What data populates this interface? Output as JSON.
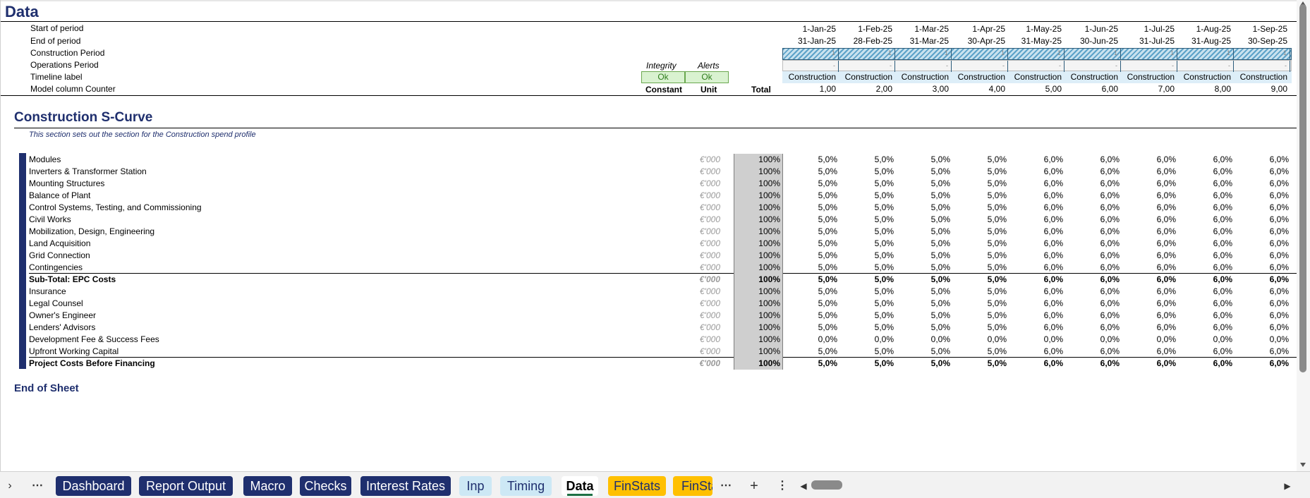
{
  "sheet_title": "Data",
  "timeline_labels": [
    "Start of period",
    "End of period",
    "Construction Period",
    "Operations Period",
    "Timeline label",
    "Model column Counter"
  ],
  "integrity": {
    "label": "Integrity",
    "value": "Ok"
  },
  "alerts": {
    "label": "Alerts",
    "value": "Ok"
  },
  "col_headers": {
    "constant": "Constant",
    "unit": "Unit",
    "total": "Total"
  },
  "period_columns": [
    {
      "start": "1-Jan-25",
      "end": "31-Jan-25",
      "construction": "1",
      "operations": "-",
      "label": "Construction",
      "counter": "1,00"
    },
    {
      "start": "1-Feb-25",
      "end": "28-Feb-25",
      "construction": "1",
      "operations": "-",
      "label": "Construction",
      "counter": "2,00"
    },
    {
      "start": "1-Mar-25",
      "end": "31-Mar-25",
      "construction": "1",
      "operations": "-",
      "label": "Construction",
      "counter": "3,00"
    },
    {
      "start": "1-Apr-25",
      "end": "30-Apr-25",
      "construction": "1",
      "operations": "-",
      "label": "Construction",
      "counter": "4,00"
    },
    {
      "start": "1-May-25",
      "end": "31-May-25",
      "construction": "1",
      "operations": "-",
      "label": "Construction",
      "counter": "5,00"
    },
    {
      "start": "1-Jun-25",
      "end": "30-Jun-25",
      "construction": "1",
      "operations": "-",
      "label": "Construction",
      "counter": "6,00"
    },
    {
      "start": "1-Jul-25",
      "end": "31-Jul-25",
      "construction": "1",
      "operations": "-",
      "label": "Construction",
      "counter": "7,00"
    },
    {
      "start": "1-Aug-25",
      "end": "31-Aug-25",
      "construction": "1",
      "operations": "-",
      "label": "Construction",
      "counter": "8,00"
    },
    {
      "start": "1-Sep-25",
      "end": "30-Sep-25",
      "construction": "1",
      "operations": "-",
      "label": "Construction",
      "counter": "9,00"
    }
  ],
  "section": {
    "title": "Construction S-Curve",
    "description": "This section sets out the section for the Construction spend profile"
  },
  "rows": [
    {
      "label": "Modules",
      "unit": "€'000",
      "constant": "100%",
      "values": [
        "5,0%",
        "5,0%",
        "5,0%",
        "5,0%",
        "6,0%",
        "6,0%",
        "6,0%",
        "6,0%",
        "6,0%"
      ],
      "bold": false
    },
    {
      "label": "Inverters & Transformer Station",
      "unit": "€'000",
      "constant": "100%",
      "values": [
        "5,0%",
        "5,0%",
        "5,0%",
        "5,0%",
        "6,0%",
        "6,0%",
        "6,0%",
        "6,0%",
        "6,0%"
      ],
      "bold": false
    },
    {
      "label": "Mounting Structures",
      "unit": "€'000",
      "constant": "100%",
      "values": [
        "5,0%",
        "5,0%",
        "5,0%",
        "5,0%",
        "6,0%",
        "6,0%",
        "6,0%",
        "6,0%",
        "6,0%"
      ],
      "bold": false
    },
    {
      "label": "Balance of Plant",
      "unit": "€'000",
      "constant": "100%",
      "values": [
        "5,0%",
        "5,0%",
        "5,0%",
        "5,0%",
        "6,0%",
        "6,0%",
        "6,0%",
        "6,0%",
        "6,0%"
      ],
      "bold": false
    },
    {
      "label": "Control Systems, Testing, and Commissioning",
      "unit": "€'000",
      "constant": "100%",
      "values": [
        "5,0%",
        "5,0%",
        "5,0%",
        "5,0%",
        "6,0%",
        "6,0%",
        "6,0%",
        "6,0%",
        "6,0%"
      ],
      "bold": false
    },
    {
      "label": "Civil Works",
      "unit": "€'000",
      "constant": "100%",
      "values": [
        "5,0%",
        "5,0%",
        "5,0%",
        "5,0%",
        "6,0%",
        "6,0%",
        "6,0%",
        "6,0%",
        "6,0%"
      ],
      "bold": false
    },
    {
      "label": "Mobilization, Design, Engineering",
      "unit": "€'000",
      "constant": "100%",
      "values": [
        "5,0%",
        "5,0%",
        "5,0%",
        "5,0%",
        "6,0%",
        "6,0%",
        "6,0%",
        "6,0%",
        "6,0%"
      ],
      "bold": false
    },
    {
      "label": "Land Acquisition",
      "unit": "€'000",
      "constant": "100%",
      "values": [
        "5,0%",
        "5,0%",
        "5,0%",
        "5,0%",
        "6,0%",
        "6,0%",
        "6,0%",
        "6,0%",
        "6,0%"
      ],
      "bold": false
    },
    {
      "label": "Grid Connection",
      "unit": "€'000",
      "constant": "100%",
      "values": [
        "5,0%",
        "5,0%",
        "5,0%",
        "5,0%",
        "6,0%",
        "6,0%",
        "6,0%",
        "6,0%",
        "6,0%"
      ],
      "bold": false
    },
    {
      "label": "Contingencies",
      "unit": "€'000",
      "constant": "100%",
      "values": [
        "5,0%",
        "5,0%",
        "5,0%",
        "5,0%",
        "6,0%",
        "6,0%",
        "6,0%",
        "6,0%",
        "6,0%"
      ],
      "bold": false
    },
    {
      "label": "Sub-Total: EPC Costs",
      "unit": "€'000",
      "constant": "100%",
      "values": [
        "5,0%",
        "5,0%",
        "5,0%",
        "5,0%",
        "6,0%",
        "6,0%",
        "6,0%",
        "6,0%",
        "6,0%"
      ],
      "bold": true
    },
    {
      "label": "Insurance",
      "unit": "€'000",
      "constant": "100%",
      "values": [
        "5,0%",
        "5,0%",
        "5,0%",
        "5,0%",
        "6,0%",
        "6,0%",
        "6,0%",
        "6,0%",
        "6,0%"
      ],
      "bold": false
    },
    {
      "label": "Legal Counsel",
      "unit": "€'000",
      "constant": "100%",
      "values": [
        "5,0%",
        "5,0%",
        "5,0%",
        "5,0%",
        "6,0%",
        "6,0%",
        "6,0%",
        "6,0%",
        "6,0%"
      ],
      "bold": false
    },
    {
      "label": "Owner's Engineer",
      "unit": "€'000",
      "constant": "100%",
      "values": [
        "5,0%",
        "5,0%",
        "5,0%",
        "5,0%",
        "6,0%",
        "6,0%",
        "6,0%",
        "6,0%",
        "6,0%"
      ],
      "bold": false
    },
    {
      "label": "Lenders' Advisors",
      "unit": "€'000",
      "constant": "100%",
      "values": [
        "5,0%",
        "5,0%",
        "5,0%",
        "5,0%",
        "6,0%",
        "6,0%",
        "6,0%",
        "6,0%",
        "6,0%"
      ],
      "bold": false
    },
    {
      "label": "Development Fee & Success Fees",
      "unit": "€'000",
      "constant": "100%",
      "values": [
        "0,0%",
        "0,0%",
        "0,0%",
        "0,0%",
        "0,0%",
        "0,0%",
        "0,0%",
        "0,0%",
        "0,0%"
      ],
      "bold": false
    },
    {
      "label": "Upfront Working Capital",
      "unit": "€'000",
      "constant": "100%",
      "values": [
        "5,0%",
        "5,0%",
        "5,0%",
        "5,0%",
        "6,0%",
        "6,0%",
        "6,0%",
        "6,0%",
        "6,0%"
      ],
      "bold": false
    },
    {
      "label": "Project Costs Before Financing",
      "unit": "€'000",
      "constant": "100%",
      "values": [
        "5,0%",
        "5,0%",
        "5,0%",
        "5,0%",
        "6,0%",
        "6,0%",
        "6,0%",
        "6,0%",
        "6,0%"
      ],
      "bold": true
    }
  ],
  "end_of_sheet": "End of Sheet",
  "tabs": [
    {
      "label": "Dashboard",
      "style": "navy"
    },
    {
      "label": "Report Output",
      "style": "navy"
    },
    {
      "label": "Macro",
      "style": "navy"
    },
    {
      "label": "Checks",
      "style": "navy"
    },
    {
      "label": "Interest Rates",
      "style": "navy"
    },
    {
      "label": "Inp",
      "style": "light"
    },
    {
      "label": "Timing",
      "style": "light"
    },
    {
      "label": "Data",
      "style": "active"
    },
    {
      "label": "FinStats",
      "style": "gold"
    },
    {
      "label": "FinSta",
      "style": "gold"
    }
  ],
  "tabbar_icons": [
    "expand-icon",
    "more-icon",
    "more-icon",
    "add-sheet-icon",
    "options-icon",
    "scroll-left-icon",
    "scroll-right-icon"
  ],
  "colors": {
    "navy": "#1f2f6e",
    "light_tab": "#cde8f5",
    "gold_tab": "#ffc000",
    "ok_green": "#d9f2d0"
  }
}
